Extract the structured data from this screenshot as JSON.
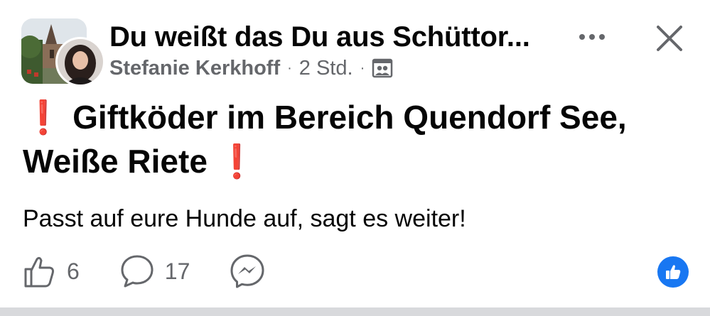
{
  "header": {
    "group_name": "Du weißt das Du aus Schüttor...",
    "author": "Stefanie Kerkhoff",
    "separator": "·",
    "time": "2 Std.",
    "privacy_icon": "group-members-icon",
    "more_icon": "more-horizontal-icon",
    "close_icon": "close-icon"
  },
  "post": {
    "title_line1": "Giftköder im Bereich Quendorf See,",
    "title_line2": "Weiße Riete",
    "exclamation": "❗",
    "body": "Passt auf eure Hunde auf, sagt es weiter!"
  },
  "actions": {
    "likes": "6",
    "comments": "17",
    "like_icon": "thumbs-up-icon",
    "comment_icon": "comment-icon",
    "share_icon": "messenger-icon"
  },
  "reaction_icon": "like-reaction-icon",
  "colors": {
    "accent": "#1877f2",
    "exclamation": "#e0201b",
    "secondary_text": "#65676b"
  }
}
